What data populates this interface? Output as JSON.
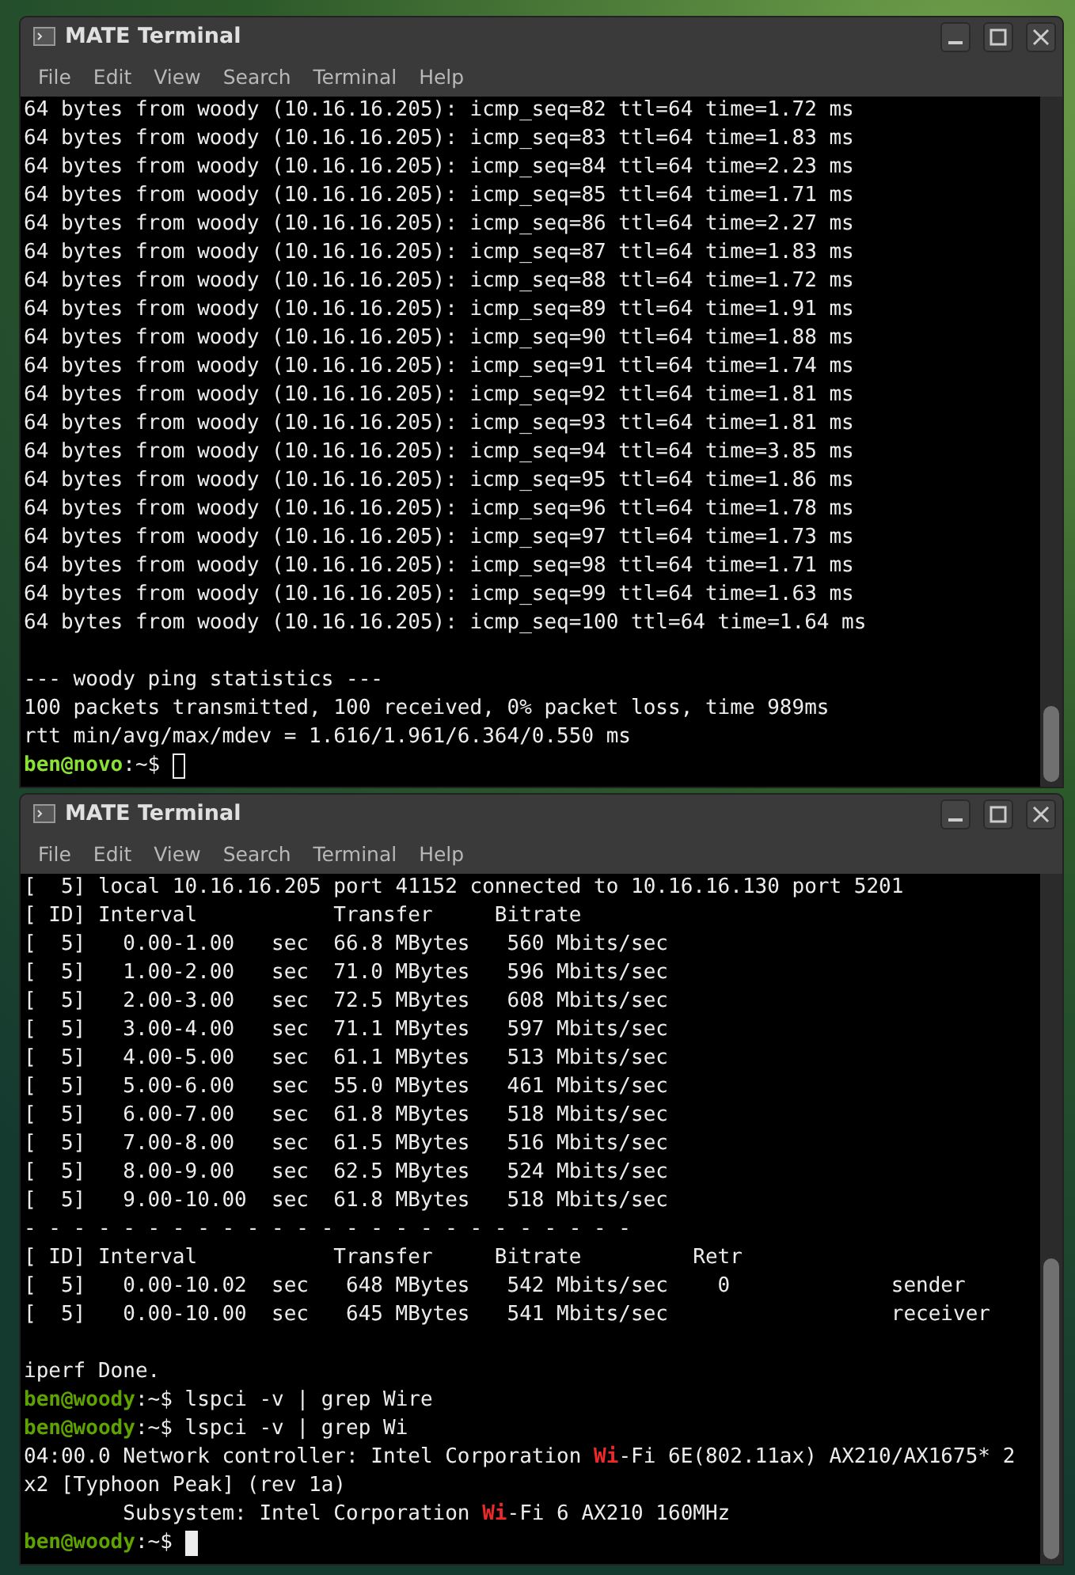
{
  "windows": [
    {
      "title": "MATE Terminal",
      "focused": false,
      "menu": [
        "File",
        "Edit",
        "View",
        "Search",
        "Terminal",
        "Help"
      ],
      "lines": [
        {
          "kind": "text",
          "text": "64 bytes from woody (10.16.16.205): icmp_seq=82 ttl=64 time=1.72 ms"
        },
        {
          "kind": "text",
          "text": "64 bytes from woody (10.16.16.205): icmp_seq=83 ttl=64 time=1.83 ms"
        },
        {
          "kind": "text",
          "text": "64 bytes from woody (10.16.16.205): icmp_seq=84 ttl=64 time=2.23 ms"
        },
        {
          "kind": "text",
          "text": "64 bytes from woody (10.16.16.205): icmp_seq=85 ttl=64 time=1.71 ms"
        },
        {
          "kind": "text",
          "text": "64 bytes from woody (10.16.16.205): icmp_seq=86 ttl=64 time=2.27 ms"
        },
        {
          "kind": "text",
          "text": "64 bytes from woody (10.16.16.205): icmp_seq=87 ttl=64 time=1.83 ms"
        },
        {
          "kind": "text",
          "text": "64 bytes from woody (10.16.16.205): icmp_seq=88 ttl=64 time=1.72 ms"
        },
        {
          "kind": "text",
          "text": "64 bytes from woody (10.16.16.205): icmp_seq=89 ttl=64 time=1.91 ms"
        },
        {
          "kind": "text",
          "text": "64 bytes from woody (10.16.16.205): icmp_seq=90 ttl=64 time=1.88 ms"
        },
        {
          "kind": "text",
          "text": "64 bytes from woody (10.16.16.205): icmp_seq=91 ttl=64 time=1.74 ms"
        },
        {
          "kind": "text",
          "text": "64 bytes from woody (10.16.16.205): icmp_seq=92 ttl=64 time=1.81 ms"
        },
        {
          "kind": "text",
          "text": "64 bytes from woody (10.16.16.205): icmp_seq=93 ttl=64 time=1.81 ms"
        },
        {
          "kind": "text",
          "text": "64 bytes from woody (10.16.16.205): icmp_seq=94 ttl=64 time=3.85 ms"
        },
        {
          "kind": "text",
          "text": "64 bytes from woody (10.16.16.205): icmp_seq=95 ttl=64 time=1.86 ms"
        },
        {
          "kind": "text",
          "text": "64 bytes from woody (10.16.16.205): icmp_seq=96 ttl=64 time=1.78 ms"
        },
        {
          "kind": "text",
          "text": "64 bytes from woody (10.16.16.205): icmp_seq=97 ttl=64 time=1.73 ms"
        },
        {
          "kind": "text",
          "text": "64 bytes from woody (10.16.16.205): icmp_seq=98 ttl=64 time=1.71 ms"
        },
        {
          "kind": "text",
          "text": "64 bytes from woody (10.16.16.205): icmp_seq=99 ttl=64 time=1.63 ms"
        },
        {
          "kind": "text",
          "text": "64 bytes from woody (10.16.16.205): icmp_seq=100 ttl=64 time=1.64 ms"
        },
        {
          "kind": "blank"
        },
        {
          "kind": "text",
          "text": "--- woody ping statistics ---"
        },
        {
          "kind": "text",
          "text": "100 packets transmitted, 100 received, 0% packet loss, time 989ms"
        },
        {
          "kind": "text",
          "text": "rtt min/avg/max/mdev = 1.616/1.961/6.364/0.550 ms"
        },
        {
          "kind": "text",
          "segments": [
            {
              "kind": "user",
              "text": "ben@novo",
              "color": "#8ae234"
            },
            {
              "kind": "plain",
              "text": ":~$ "
            }
          ],
          "cursor": true
        }
      ]
    },
    {
      "title": "MATE Terminal",
      "focused": true,
      "menu": [
        "File",
        "Edit",
        "View",
        "Search",
        "Terminal",
        "Help"
      ],
      "lines": [
        {
          "kind": "text",
          "text": "[  5] local 10.16.16.205 port 41152 connected to 10.16.16.130 port 5201"
        },
        {
          "kind": "text",
          "text": "[ ID] Interval           Transfer     Bitrate"
        },
        {
          "kind": "text",
          "text": "[  5]   0.00-1.00   sec  66.8 MBytes   560 Mbits/sec"
        },
        {
          "kind": "text",
          "text": "[  5]   1.00-2.00   sec  71.0 MBytes   596 Mbits/sec"
        },
        {
          "kind": "text",
          "text": "[  5]   2.00-3.00   sec  72.5 MBytes   608 Mbits/sec"
        },
        {
          "kind": "text",
          "text": "[  5]   3.00-4.00   sec  71.1 MBytes   597 Mbits/sec"
        },
        {
          "kind": "text",
          "text": "[  5]   4.00-5.00   sec  61.1 MBytes   513 Mbits/sec"
        },
        {
          "kind": "text",
          "text": "[  5]   5.00-6.00   sec  55.0 MBytes   461 Mbits/sec"
        },
        {
          "kind": "text",
          "text": "[  5]   6.00-7.00   sec  61.8 MBytes   518 Mbits/sec"
        },
        {
          "kind": "text",
          "text": "[  5]   7.00-8.00   sec  61.5 MBytes   516 Mbits/sec"
        },
        {
          "kind": "text",
          "text": "[  5]   8.00-9.00   sec  62.5 MBytes   524 Mbits/sec"
        },
        {
          "kind": "text",
          "text": "[  5]   9.00-10.00  sec  61.8 MBytes   518 Mbits/sec"
        },
        {
          "kind": "text",
          "text": "- - - - - - - - - - - - - - - - - - - - - - - - -"
        },
        {
          "kind": "text",
          "text": "[ ID] Interval           Transfer     Bitrate         Retr"
        },
        {
          "kind": "text",
          "text": "[  5]   0.00-10.02  sec   648 MBytes   542 Mbits/sec    0             sender"
        },
        {
          "kind": "text",
          "text": "[  5]   0.00-10.00  sec   645 MBytes   541 Mbits/sec                  receiver"
        },
        {
          "kind": "blank"
        },
        {
          "kind": "text",
          "text": "iperf Done."
        },
        {
          "kind": "text",
          "segments": [
            {
              "kind": "user",
              "text": "ben@woody",
              "color": "#5fa300"
            },
            {
              "kind": "plain",
              "text": ":~$ lspci -v | grep Wire"
            }
          ]
        },
        {
          "kind": "text",
          "segments": [
            {
              "kind": "user",
              "text": "ben@woody",
              "color": "#5fa300"
            },
            {
              "kind": "plain",
              "text": ":~$ lspci -v | grep Wi"
            }
          ]
        },
        {
          "kind": "text",
          "segments": [
            {
              "kind": "plain",
              "text": "04:00.0 Network controller: Intel Corporation "
            },
            {
              "kind": "match",
              "text": "Wi"
            },
            {
              "kind": "plain",
              "text": "-Fi 6E(802.11ax) AX210/AX1675* 2"
            }
          ]
        },
        {
          "kind": "text",
          "text": "x2 [Typhoon Peak] (rev 1a)"
        },
        {
          "kind": "text",
          "segments": [
            {
              "kind": "plain",
              "text": "        Subsystem: Intel Corporation "
            },
            {
              "kind": "match",
              "text": "Wi"
            },
            {
              "kind": "plain",
              "text": "-Fi 6 AX210 160MHz"
            }
          ]
        },
        {
          "kind": "text",
          "segments": [
            {
              "kind": "user",
              "text": "ben@woody",
              "color": "#5fa300"
            },
            {
              "kind": "plain",
              "text": ":~$ "
            }
          ],
          "cursor": true
        }
      ]
    }
  ]
}
